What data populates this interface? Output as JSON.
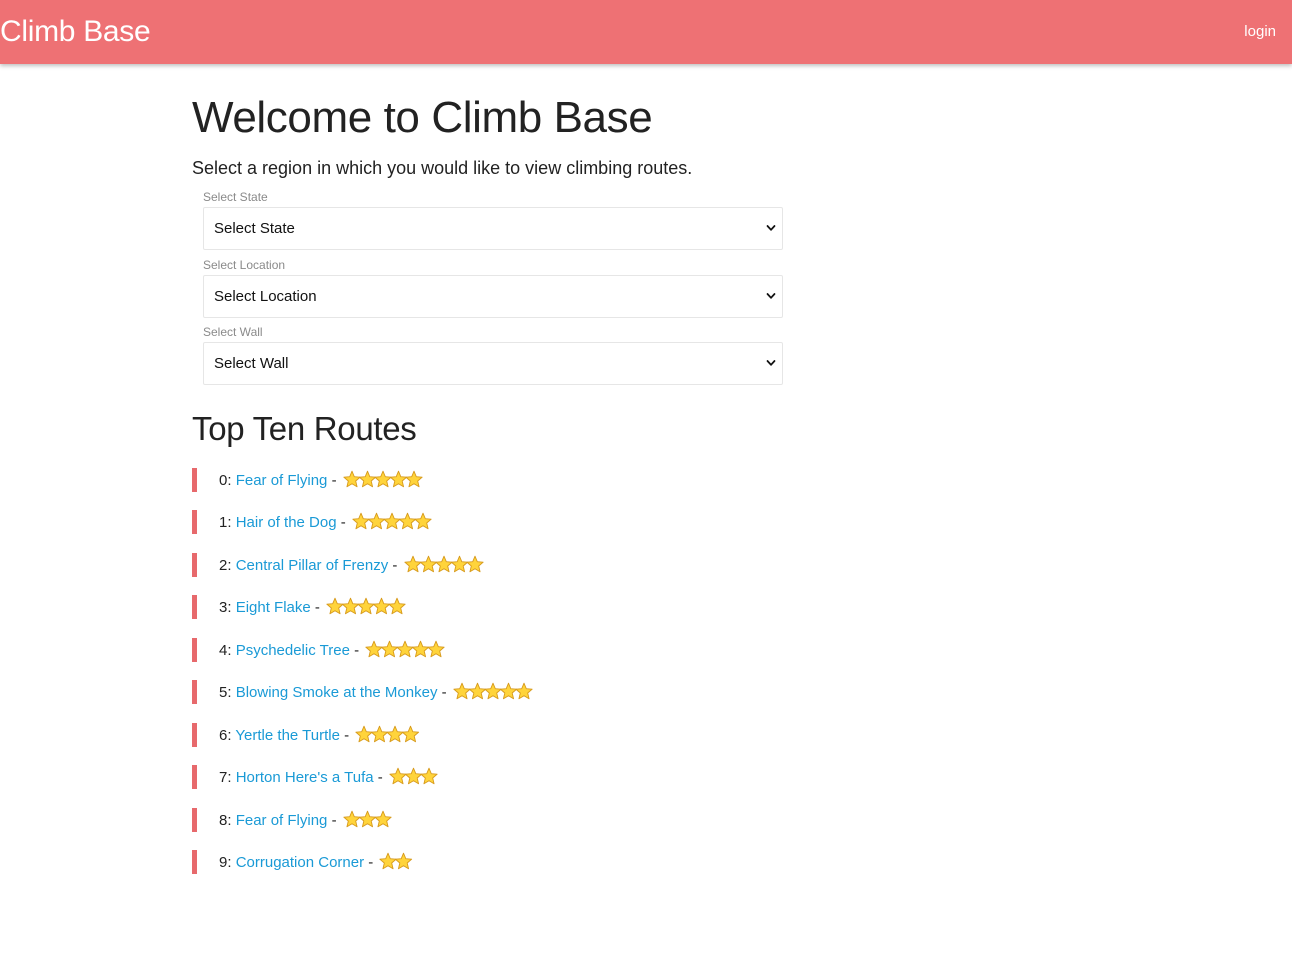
{
  "header": {
    "brand": "Climb Base",
    "login_label": "login"
  },
  "main": {
    "title": "Welcome to Climb Base",
    "intro": "Select a region in which you would like to view climbing routes.",
    "filters": [
      {
        "label": "Select State",
        "value": "Select State"
      },
      {
        "label": "Select Location",
        "value": "Select Location"
      },
      {
        "label": "Select Wall",
        "value": "Select Wall"
      }
    ],
    "top_routes_title": "Top Ten Routes",
    "routes": [
      {
        "prefix": "0:",
        "name": "Fear of Flying",
        "sep": "-",
        "stars": 5
      },
      {
        "prefix": "1:",
        "name": "Hair of the Dog",
        "sep": "-",
        "stars": 5
      },
      {
        "prefix": "2:",
        "name": "Central Pillar of Frenzy",
        "sep": "-",
        "stars": 5
      },
      {
        "prefix": "3:",
        "name": "Eight Flake",
        "sep": "-",
        "stars": 5
      },
      {
        "prefix": "4:",
        "name": "Psychedelic Tree",
        "sep": "-",
        "stars": 5
      },
      {
        "prefix": "5:",
        "name": "Blowing Smoke at the Monkey",
        "sep": "-",
        "stars": 5
      },
      {
        "prefix": "6:",
        "name": "Yertle the Turtle",
        "sep": "-",
        "stars": 4
      },
      {
        "prefix": "7:",
        "name": "Horton Here's a Tufa",
        "sep": "-",
        "stars": 3
      },
      {
        "prefix": "8:",
        "name": "Fear of Flying",
        "sep": "-",
        "stars": 3
      },
      {
        "prefix": "9:",
        "name": "Corrugation Corner",
        "sep": "-",
        "stars": 2
      }
    ]
  },
  "colors": {
    "navbar": "#ee7174",
    "accent_bar": "#e7696c",
    "link": "#1a9ad6",
    "star_fill": "#ffd43b"
  },
  "icons": {
    "rating": "star-icon",
    "dropdown": "chevron-down-icon"
  }
}
